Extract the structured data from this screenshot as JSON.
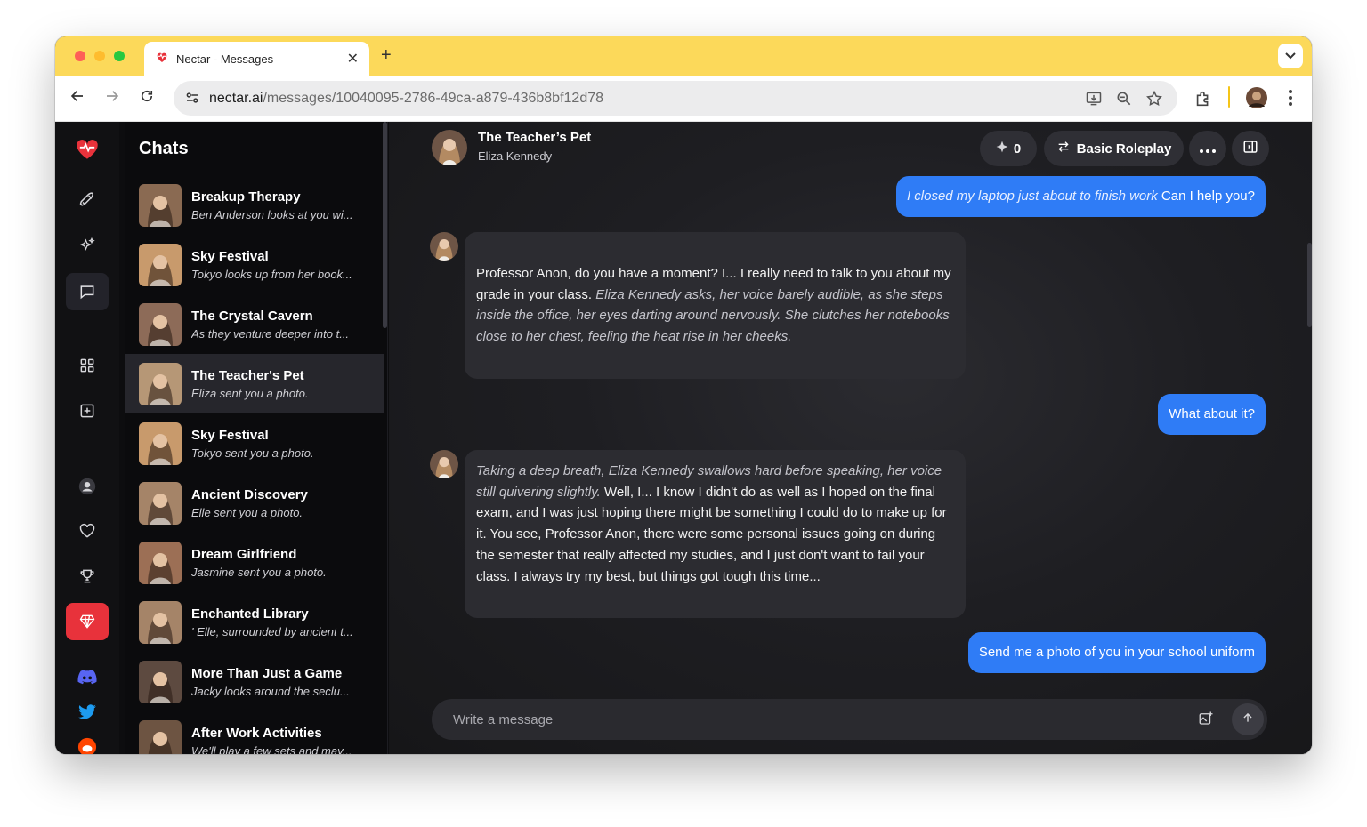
{
  "browser": {
    "tab_title": "Nectar - Messages",
    "url_host": "nectar.ai",
    "url_path": "/messages/10040095-2786-49ca-a879-436b8bf12d78",
    "tabbar_color": "#fcd95a"
  },
  "sidebar": {
    "heading": "Chats",
    "items": [
      {
        "name": "Breakup Therapy",
        "preview": "Ben Anderson looks at you wi...",
        "avatar_color": "#8a6a52"
      },
      {
        "name": "Sky Festival",
        "preview": "Tokyo looks up from her book...",
        "avatar_color": "#c89a6c"
      },
      {
        "name": "The Crystal Cavern",
        "preview": "As they venture deeper into t...",
        "avatar_color": "#8d6b58"
      },
      {
        "name": "The Teacher's Pet",
        "preview": "Eliza sent you a photo.",
        "avatar_color": "#b69776",
        "selected": true
      },
      {
        "name": "Sky Festival",
        "preview": "Tokyo sent you a photo.",
        "avatar_color": "#c89a6c"
      },
      {
        "name": "Ancient Discovery",
        "preview": "Elle sent you a photo.",
        "avatar_color": "#a58468"
      },
      {
        "name": "Dream Girlfriend",
        "preview": "Jasmine sent you a photo.",
        "avatar_color": "#9c6f55"
      },
      {
        "name": "Enchanted Library",
        "preview": "' Elle, surrounded by ancient t...",
        "avatar_color": "#a58468"
      },
      {
        "name": "More Than Just a Game",
        "preview": "Jacky looks around the seclu...",
        "avatar_color": "#5d4a40"
      },
      {
        "name": "After Work Activities",
        "preview": "We'll play a few sets and may...",
        "avatar_color": "#6d5442"
      }
    ]
  },
  "header": {
    "character_name": "The Teacher’s Pet",
    "character_sub": "Eliza Kennedy",
    "count": "0",
    "mode_label": "Basic Roleplay"
  },
  "messages": {
    "m1": {
      "italic": "I closed my laptop just about to finish work",
      "text": " Can I help you?"
    },
    "m2": {
      "text": "Professor Anon, do you have a moment? I... I really need to talk to you about my grade in your class. ",
      "italic": "Eliza Kennedy asks, her voice barely audible, as she steps inside the office, her eyes darting around nervously. She clutches her notebooks close to her chest, feeling the heat rise in her cheeks."
    },
    "m3": {
      "text": "What about it?"
    },
    "m4": {
      "italic": "Taking a deep breath, Eliza Kennedy swallows hard before speaking, her voice still quivering slightly.",
      "text": " Well, I... I know I didn't do as well as I hoped on the final exam, and I was just hoping there might be something I could do to make up for it. You see, Professor Anon, there were some personal issues going on during the semester that really affected my studies, and I just don't want to fail your class. I always try my best, but things got tough this time..."
    },
    "m5": {
      "text": "Send me a photo of you in your school uniform"
    }
  },
  "composer": {
    "placeholder": "Write a message"
  },
  "colors": {
    "accent_blue": "#2f7cf6",
    "brand_red": "#e8323b"
  }
}
